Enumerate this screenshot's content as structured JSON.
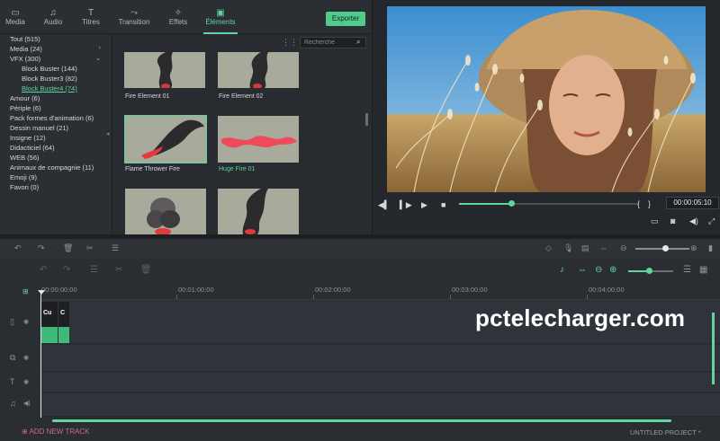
{
  "tabs": [
    {
      "label": "Media",
      "icon": "folder-icon"
    },
    {
      "label": "Audio",
      "icon": "music-note-icon"
    },
    {
      "label": "Titres",
      "icon": "text-icon"
    },
    {
      "label": "Transition",
      "icon": "transition-icon"
    },
    {
      "label": "Effets",
      "icon": "effects-icon"
    },
    {
      "label": "Éléments",
      "icon": "image-icon",
      "active": true
    }
  ],
  "export_label": "Exporter",
  "categories": [
    {
      "label": "Tout (515)"
    },
    {
      "label": "Media (24)"
    },
    {
      "label": "VFX (300)"
    },
    {
      "label": "Block Buster (144)"
    },
    {
      "label": "Block Buster3 (82)"
    },
    {
      "label": "Block Buster4 (74)"
    },
    {
      "label": "Amour (6)"
    },
    {
      "label": "Périple (6)"
    },
    {
      "label": "Pack formes d'animation (6)"
    },
    {
      "label": "Dessin manuel (21)"
    },
    {
      "label": "Insigne (12)"
    },
    {
      "label": "Didacticiel (64)"
    },
    {
      "label": "WEB (56)"
    },
    {
      "label": "Animaux de compagnie (11)"
    },
    {
      "label": "Emoji (9)"
    },
    {
      "label": "Favori (0)"
    }
  ],
  "search": {
    "placeholder": "Recherche"
  },
  "elements": [
    {
      "label": "Fire Element 01"
    },
    {
      "label": "Fire Element 02"
    },
    {
      "label": "Flame Thrower Fire"
    },
    {
      "label": "Huge Fire 01"
    }
  ],
  "preview": {
    "timecode": "00:00:05:10",
    "progress": 0.29
  },
  "ruler": [
    "00:00:00:00",
    "00:01:00:00",
    "00:02:00:00",
    "00:03:00:00",
    "00:04:00:00"
  ],
  "clips": [
    "Cu",
    "C"
  ],
  "watermark": "pctelecharger.com",
  "add_track_label": "ADD NEW TRACK",
  "project_label": "UNTITLED PROJECT *",
  "colors": {
    "accent": "#5fd69e",
    "panel": "#2b2e33",
    "export": "#4fcb8b",
    "add_track": "#d06a8a"
  }
}
